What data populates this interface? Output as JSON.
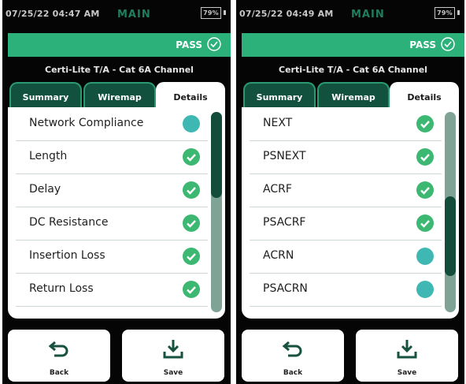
{
  "screens": [
    {
      "status": {
        "time": "07/25/22 04:47 AM",
        "mode": "MAIN",
        "battery": "79%"
      },
      "pass_label": "PASS",
      "title": "Certi-Lite T/A - Cat 6A Channel",
      "tabs": {
        "summary": "Summary",
        "wiremap": "Wiremap",
        "details": "Details"
      },
      "rows": [
        {
          "label": "Network Compliance",
          "status": "info"
        },
        {
          "label": "Length",
          "status": "pass"
        },
        {
          "label": "Delay",
          "status": "pass"
        },
        {
          "label": "DC Resistance",
          "status": "pass"
        },
        {
          "label": "Insertion Loss",
          "status": "pass"
        },
        {
          "label": "Return Loss",
          "status": "pass"
        }
      ],
      "scroll": {
        "thumb_start": 0.0,
        "thumb_end": 0.43
      },
      "buttons": {
        "back": "Back",
        "save": "Save"
      }
    },
    {
      "status": {
        "time": "07/25/22 04:49 AM",
        "mode": "MAIN",
        "battery": "79%"
      },
      "pass_label": "PASS",
      "title": "Certi-Lite T/A - Cat 6A Channel",
      "tabs": {
        "summary": "Summary",
        "wiremap": "Wiremap",
        "details": "Details"
      },
      "rows": [
        {
          "label": "NEXT",
          "status": "pass"
        },
        {
          "label": "PSNEXT",
          "status": "pass"
        },
        {
          "label": "ACRF",
          "status": "pass"
        },
        {
          "label": "PSACRF",
          "status": "pass"
        },
        {
          "label": "ACRN",
          "status": "info"
        },
        {
          "label": "PSACRN",
          "status": "info"
        }
      ],
      "scroll": {
        "thumb_start": 0.42,
        "thumb_end": 0.82
      },
      "buttons": {
        "back": "Back",
        "save": "Save"
      }
    }
  ],
  "colors": {
    "accent": "#2bb179",
    "tab_dark": "#13513f",
    "pass": "#3cb872",
    "info": "#3fb8b4"
  }
}
